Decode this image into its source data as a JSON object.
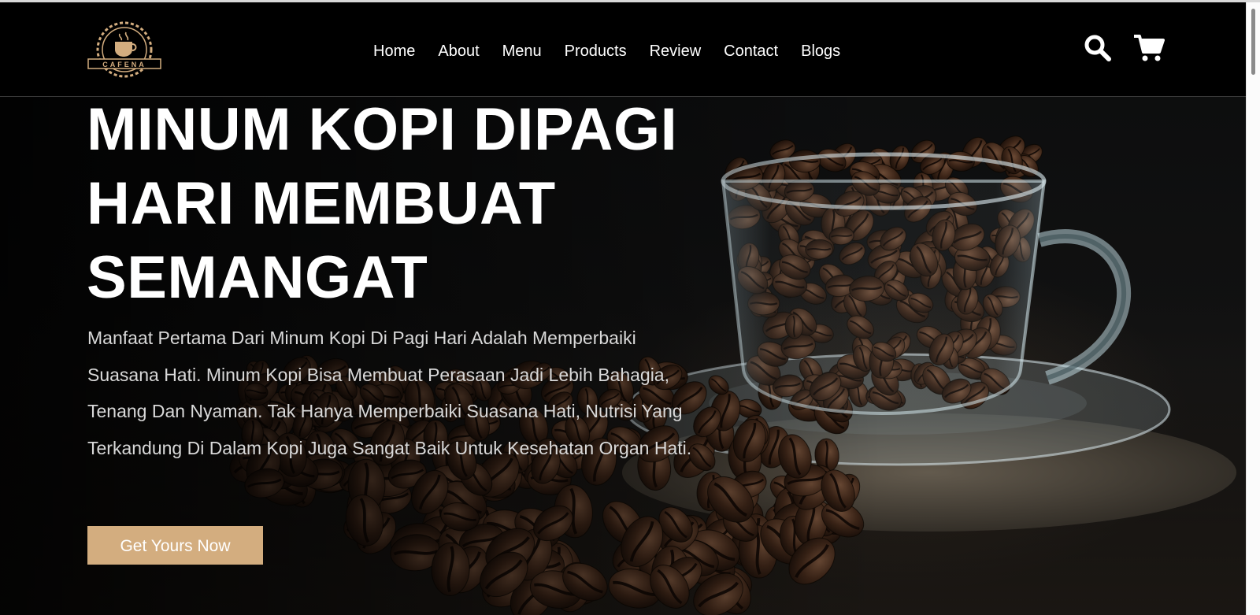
{
  "brand": {
    "logo_text": "CAFENA",
    "accent_color": "#d3ad7f"
  },
  "nav": {
    "items": [
      {
        "label": "Home"
      },
      {
        "label": "About"
      },
      {
        "label": "Menu"
      },
      {
        "label": "Products"
      },
      {
        "label": "Review"
      },
      {
        "label": "Contact"
      },
      {
        "label": "Blogs"
      }
    ],
    "icons": [
      "search-icon",
      "cart-icon"
    ]
  },
  "hero": {
    "title_lines": [
      "MINUM KOPI DIPAGI",
      "HARI MEMBUAT",
      "SEMANGAT"
    ],
    "description": "Manfaat Pertama Dari Minum Kopi Di Pagi Hari Adalah Memperbaiki Suasana Hati. Minum Kopi Bisa Membuat Perasaan Jadi Lebih Bahagia, Tenang Dan Nyaman. Tak Hanya Memperbaiki Suasana Hati, Nutrisi Yang Terkandung Di Dalam Kopi Juga Sangat Baik Untuk Kesehatan Organ Hati.",
    "cta_label": "Get Yours Now",
    "background_image": "coffee-beans-in-glass-cup-on-saucer"
  }
}
